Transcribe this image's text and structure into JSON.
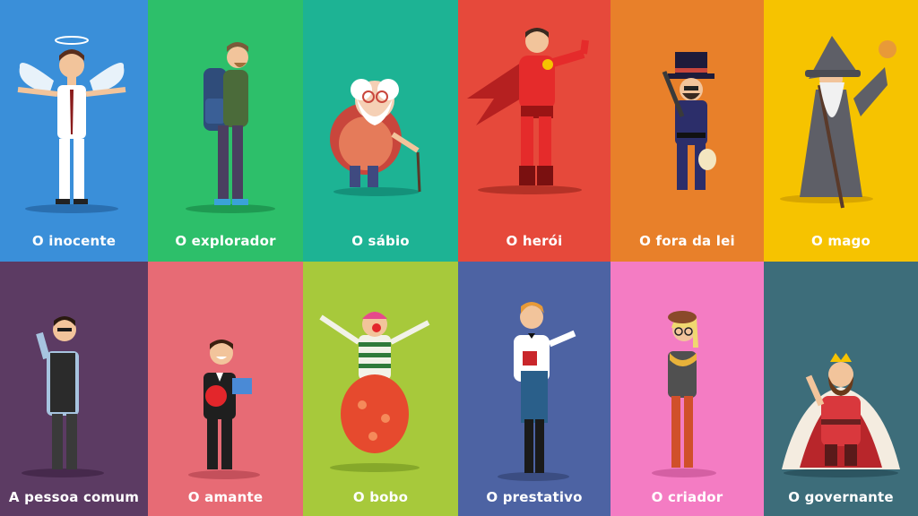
{
  "archetypes": [
    {
      "label": "O inocente",
      "bg": "#3a8fd9"
    },
    {
      "label": "O explorador",
      "bg": "#2dbf6a"
    },
    {
      "label": "O sábio",
      "bg": "#1db394"
    },
    {
      "label": "O herói",
      "bg": "#e6493b"
    },
    {
      "label": "O fora da lei",
      "bg": "#e8802a"
    },
    {
      "label": "O mago",
      "bg": "#f6c300"
    },
    {
      "label": "A pessoa comum",
      "bg": "#5c3b63"
    },
    {
      "label": "O amante",
      "bg": "#e76b75"
    },
    {
      "label": "O bobo",
      "bg": "#a7c93b"
    },
    {
      "label": "O prestativo",
      "bg": "#4d63a3"
    },
    {
      "label": "O criador",
      "bg": "#f47cc3"
    },
    {
      "label": "O governante",
      "bg": "#3d6d7a"
    }
  ]
}
